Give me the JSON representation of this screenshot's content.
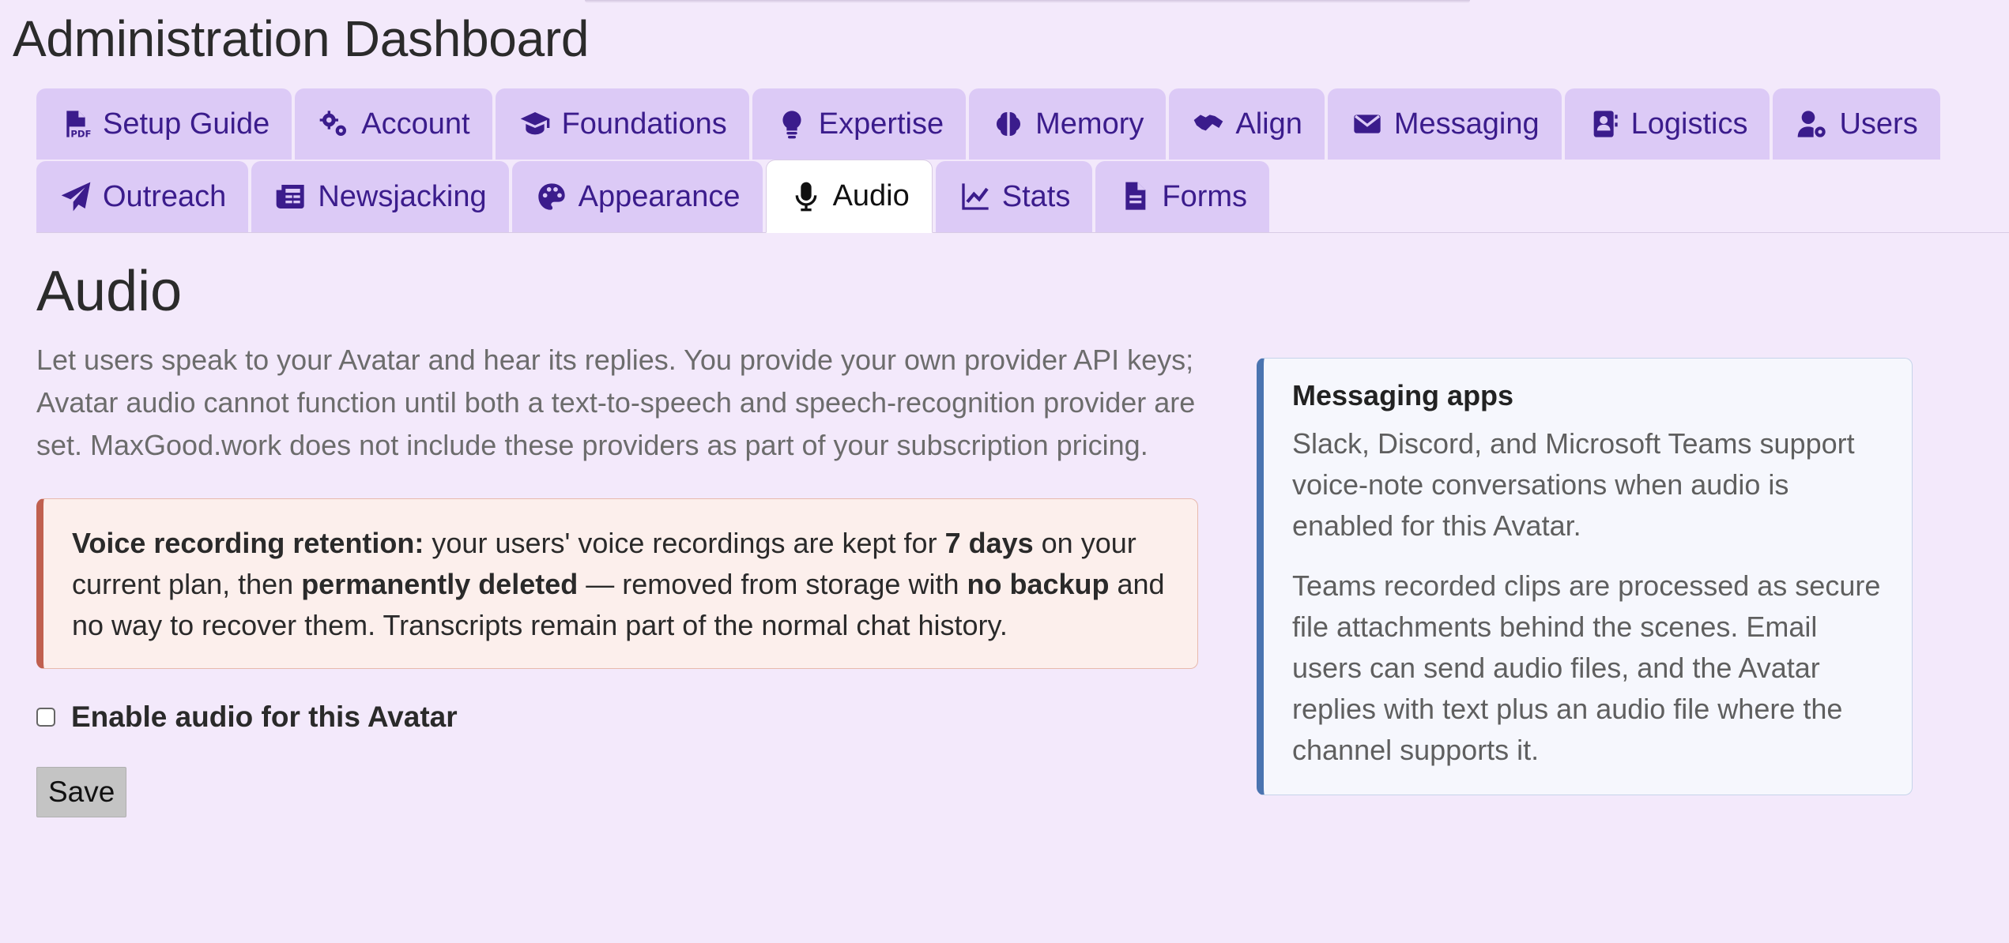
{
  "app": {
    "title": "Administration Dashboard"
  },
  "tabs": {
    "row1": [
      {
        "label": "Setup Guide",
        "icon": "file-pdf-icon"
      },
      {
        "label": "Account",
        "icon": "gears-icon"
      },
      {
        "label": "Foundations",
        "icon": "graduation-cap-icon"
      },
      {
        "label": "Expertise",
        "icon": "lightbulb-icon"
      },
      {
        "label": "Memory",
        "icon": "brain-icon"
      },
      {
        "label": "Align",
        "icon": "handshake-icon"
      },
      {
        "label": "Messaging",
        "icon": "envelope-icon"
      },
      {
        "label": "Logistics",
        "icon": "address-book-icon"
      },
      {
        "label": "Users",
        "icon": "user-gear-icon"
      }
    ],
    "row2": [
      {
        "label": "Outreach",
        "icon": "paper-plane-icon"
      },
      {
        "label": "Newsjacking",
        "icon": "newspaper-icon"
      },
      {
        "label": "Appearance",
        "icon": "palette-icon"
      },
      {
        "label": "Audio",
        "icon": "microphone-icon",
        "active": true
      },
      {
        "label": "Stats",
        "icon": "chart-line-icon"
      },
      {
        "label": "Forms",
        "icon": "file-lines-icon"
      }
    ]
  },
  "main": {
    "title": "Audio",
    "intro": "Let users speak to your Avatar and hear its replies. You provide your own provider API keys; Avatar audio cannot function until both a text-to-speech and speech-recognition provider are set. MaxGood.work does not include these providers as part of your subscription pricing.",
    "warning": {
      "label": "Voice recording retention:",
      "text1": " your users' voice recordings are kept for ",
      "bold1": "7 days",
      "text2": " on your current plan, then ",
      "bold2": "permanently deleted",
      "text3": " — removed from storage with ",
      "bold3": "no backup",
      "text4": " and no way to recover them. Transcripts remain part of the normal chat history."
    },
    "enable_label": "Enable audio for this Avatar",
    "enable_checked": false,
    "save_label": "Save"
  },
  "aside": {
    "title": "Messaging apps",
    "p1": "Slack, Discord, and Microsoft Teams support voice-note conversations when audio is enabled for this Avatar.",
    "p2": "Teams recorded clips are processed as secure file attachments behind the scenes. Email users can send audio files, and the Avatar replies with text plus an audio file where the channel supports it."
  },
  "colors": {
    "background": "#f3e9fb",
    "tab_bg": "#dccaf6",
    "tab_text": "#3b1c8c",
    "warning_border": "#c0604f",
    "warning_bg": "#fcefec",
    "info_border": "#4a74b0",
    "info_bg": "#f6f7fd"
  }
}
